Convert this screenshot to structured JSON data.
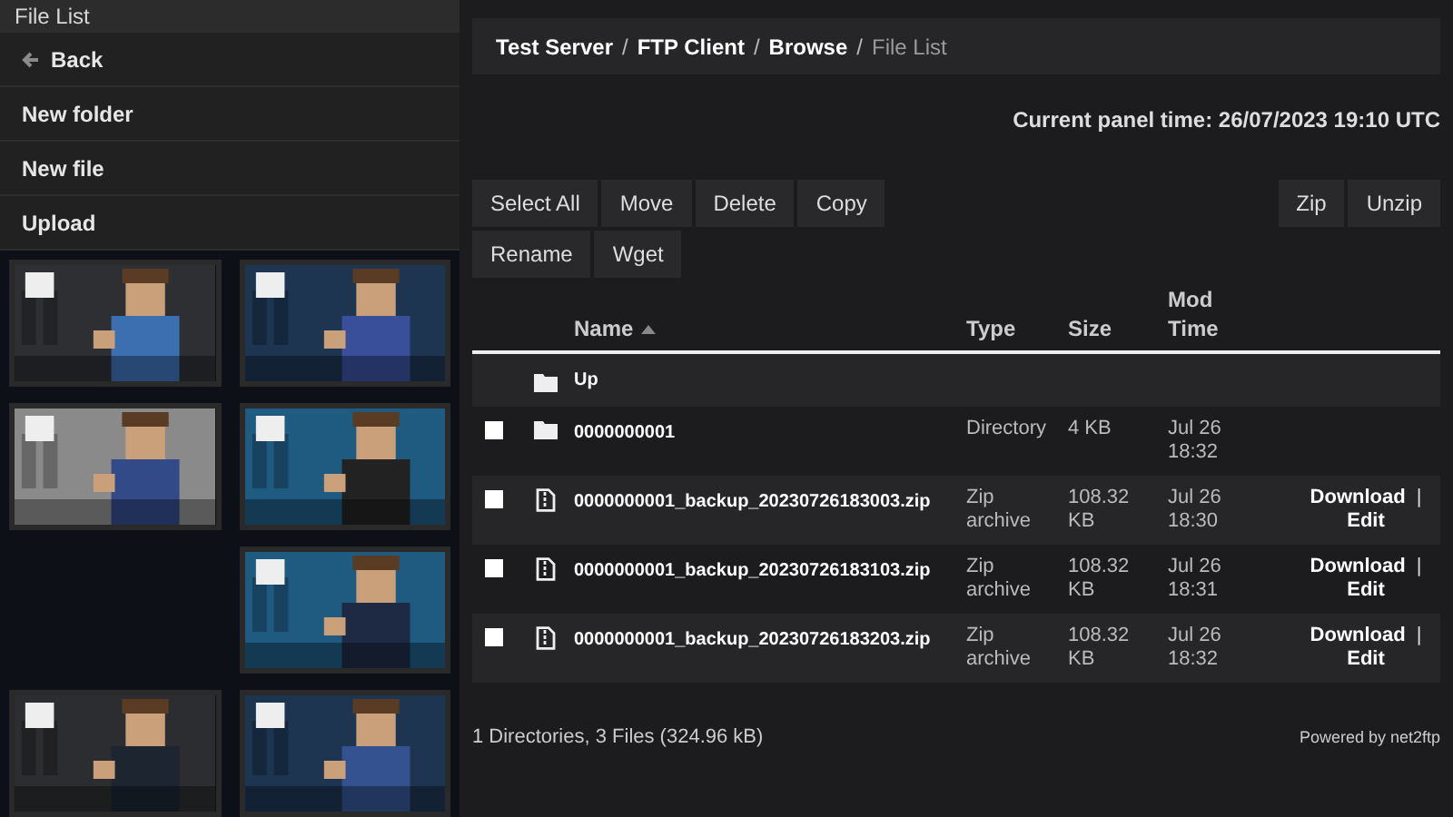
{
  "sidebar": {
    "title": "File List",
    "back": {
      "label": "Back"
    },
    "items": [
      {
        "label": "New folder"
      },
      {
        "label": "New file"
      },
      {
        "label": "Upload"
      }
    ],
    "tiles": [
      {
        "kind": "picture"
      },
      {
        "kind": "picture"
      },
      {
        "kind": "picture"
      },
      {
        "kind": "picture"
      },
      {
        "kind": "empty"
      },
      {
        "kind": "picture"
      },
      {
        "kind": "picture"
      },
      {
        "kind": "picture"
      }
    ]
  },
  "breadcrumb": [
    {
      "label": "Test Server",
      "current": false,
      "separator": "/"
    },
    {
      "label": "FTP Client",
      "current": false,
      "separator": "/"
    },
    {
      "label": "Browse",
      "current": false,
      "separator": "/"
    },
    {
      "label": "File List",
      "current": true
    }
  ],
  "panel_time": "Current panel time: 26/07/2023 19:10 UTC",
  "toolbar": {
    "left": [
      "Select All",
      "Move",
      "Delete",
      "Copy",
      "Rename",
      "Wget"
    ],
    "right": [
      "Zip",
      "Unzip"
    ]
  },
  "table": {
    "columns": [
      {
        "label": "Name",
        "sorted": true
      },
      {
        "label": "Type",
        "sorted": false
      },
      {
        "label": "Size",
        "sorted": false
      },
      {
        "label": "Mod Time",
        "sorted": false
      }
    ],
    "rows": [
      {
        "kind": "up",
        "name": "Up"
      },
      {
        "kind": "folder",
        "checked": false,
        "name": "0000000001",
        "type": "Directory",
        "size": "4 KB",
        "mod_time": "Jul 26 18:32"
      },
      {
        "kind": "file",
        "checked": false,
        "name": "0000000001_backup_20230726183003.zip",
        "type": "Zip archive",
        "size": "108.32 KB",
        "mod_time": "Jul 26 18:30",
        "actions": [
          "Download",
          "|",
          "Edit"
        ]
      },
      {
        "kind": "file",
        "checked": false,
        "name": "0000000001_backup_20230726183103.zip",
        "type": "Zip archive",
        "size": "108.32 KB",
        "mod_time": "Jul 26 18:31",
        "actions": [
          "Download",
          "|",
          "Edit"
        ]
      },
      {
        "kind": "file",
        "checked": false,
        "name": "0000000001_backup_20230726183203.zip",
        "type": "Zip archive",
        "size": "108.32 KB",
        "mod_time": "Jul 26 18:32",
        "actions": [
          "Download",
          "|",
          "Edit"
        ]
      }
    ]
  },
  "summary": "1 Directories, 3 Files (324.96 kB)",
  "powered_by": "Powered by net2ftp"
}
